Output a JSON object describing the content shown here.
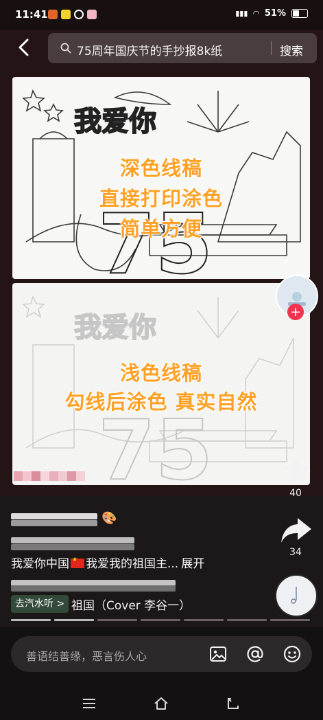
{
  "status_bar": {
    "time": "11:41",
    "battery": "51%",
    "battery_level": 0.51
  },
  "search": {
    "query": "75周年国庆节的手抄报8k纸",
    "button": "搜索"
  },
  "poster1": {
    "lines": [
      "深色线稿",
      "直接打印涂色",
      "简单方便"
    ],
    "art_text": "我爱你"
  },
  "poster2": {
    "lines": [
      "浅色线稿",
      "勾线后涂色 真实自然"
    ],
    "art_text": "我爱你"
  },
  "actions": {
    "star_count": "40",
    "share_count": "34"
  },
  "post": {
    "description_part1": "我爱你中国",
    "description_part2": "我爱我的祖国主...",
    "expand": "展开",
    "music_chip": "去汽水听 >",
    "music_title": "祖国（Cover 李谷一）"
  },
  "comment": {
    "placeholder": "善语结善缘，恶言伤人心"
  },
  "icons": {
    "back": "chevron-left-icon",
    "search": "search-icon",
    "plus": "plus-icon",
    "star": "star-icon",
    "share": "share-icon",
    "image": "image-icon",
    "mention": "at-icon",
    "emoji": "emoji-icon",
    "menu": "menu-icon",
    "home": "home-icon",
    "back_nav": "back-nav-icon"
  },
  "colors": {
    "accent_orange": "#ffa126",
    "follow_red": "#f0334f",
    "chip_green": "#33493a"
  }
}
